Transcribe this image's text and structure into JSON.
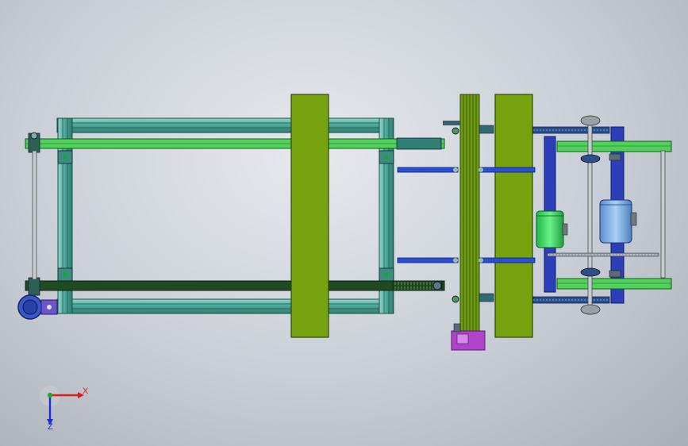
{
  "triad": {
    "x_label": "X",
    "z_label": "Z",
    "x_color": "#e11b1b",
    "y_color": "#20b020",
    "z_color": "#1a2fd6"
  },
  "colors": {
    "frame_teal": "#5fb6a8",
    "rail_green": "#4fd15a",
    "rail_dark": "#1f4a24",
    "block_olive": "#76a30f",
    "bracket_blue": "#2a4fd6",
    "motor_green": "#3fe06a",
    "motor_blue": "#7fb2e6",
    "gear_purple": "#b044c8"
  }
}
